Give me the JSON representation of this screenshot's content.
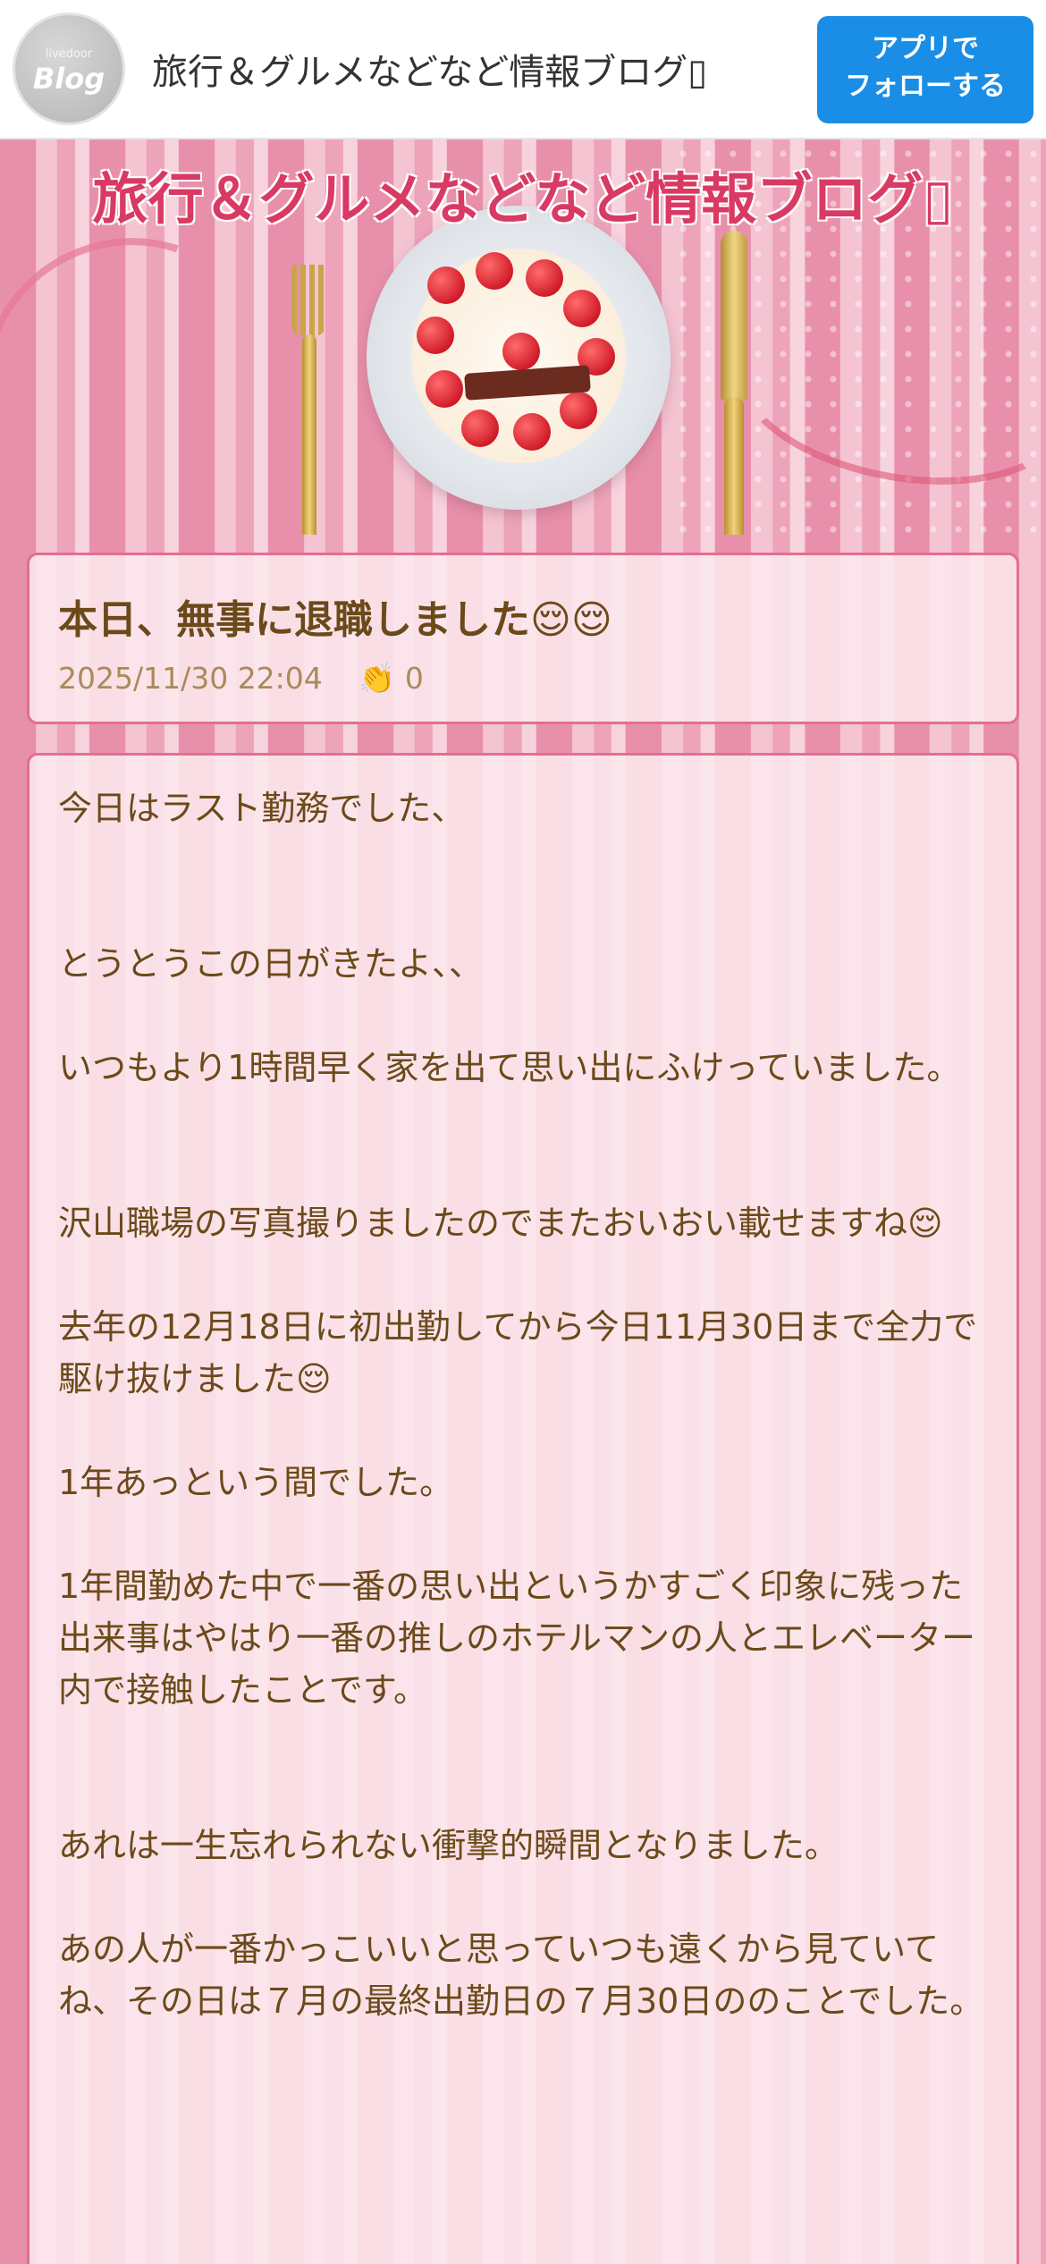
{
  "appbar": {
    "logo_small": "livedoor",
    "logo_big": "Blog",
    "title": "旅行＆グルメなどなど情報ブログ▯",
    "follow_line1": "アプリで",
    "follow_line2": "フォローする"
  },
  "banner": {
    "title": "旅行＆グルメなどなど情報ブログ▯"
  },
  "post": {
    "title": "本日、無事に退職しました😌😌",
    "datetime": "2025/11/30 22:04",
    "clap_icon": "👏",
    "clap_count": "0",
    "paragraphs": [
      "今日はラスト勤務でした、",
      "とうとうこの日がきたよ、、",
      "いつもより1時間早く家を出て思い出にふけっていました。",
      "沢山職場の写真撮りましたのでまたおいおい載せますね😌",
      "去年の12月18日に初出勤してから今日11月30日まで全力で駆け抜けました😌",
      "1年あっという間でした。",
      "1年間勤めた中で一番の思い出というかすごく印象に残った出来事はやはり一番の推しのホテルマンの人とエレベーター内で接触したことです。",
      "あれは一生忘れられない衝撃的瞬間となりました。",
      "あの人が一番かっこいいと思っていつも遠くから見ていてね、その日は７月の最終出勤日の７月30日ののことでした。"
    ]
  },
  "colors": {
    "accent": "#1a8ee6",
    "title_red": "#d93a63",
    "text_brown": "#6b4a19",
    "meta_tan": "#a98a5a",
    "card_border": "#e36e92"
  }
}
